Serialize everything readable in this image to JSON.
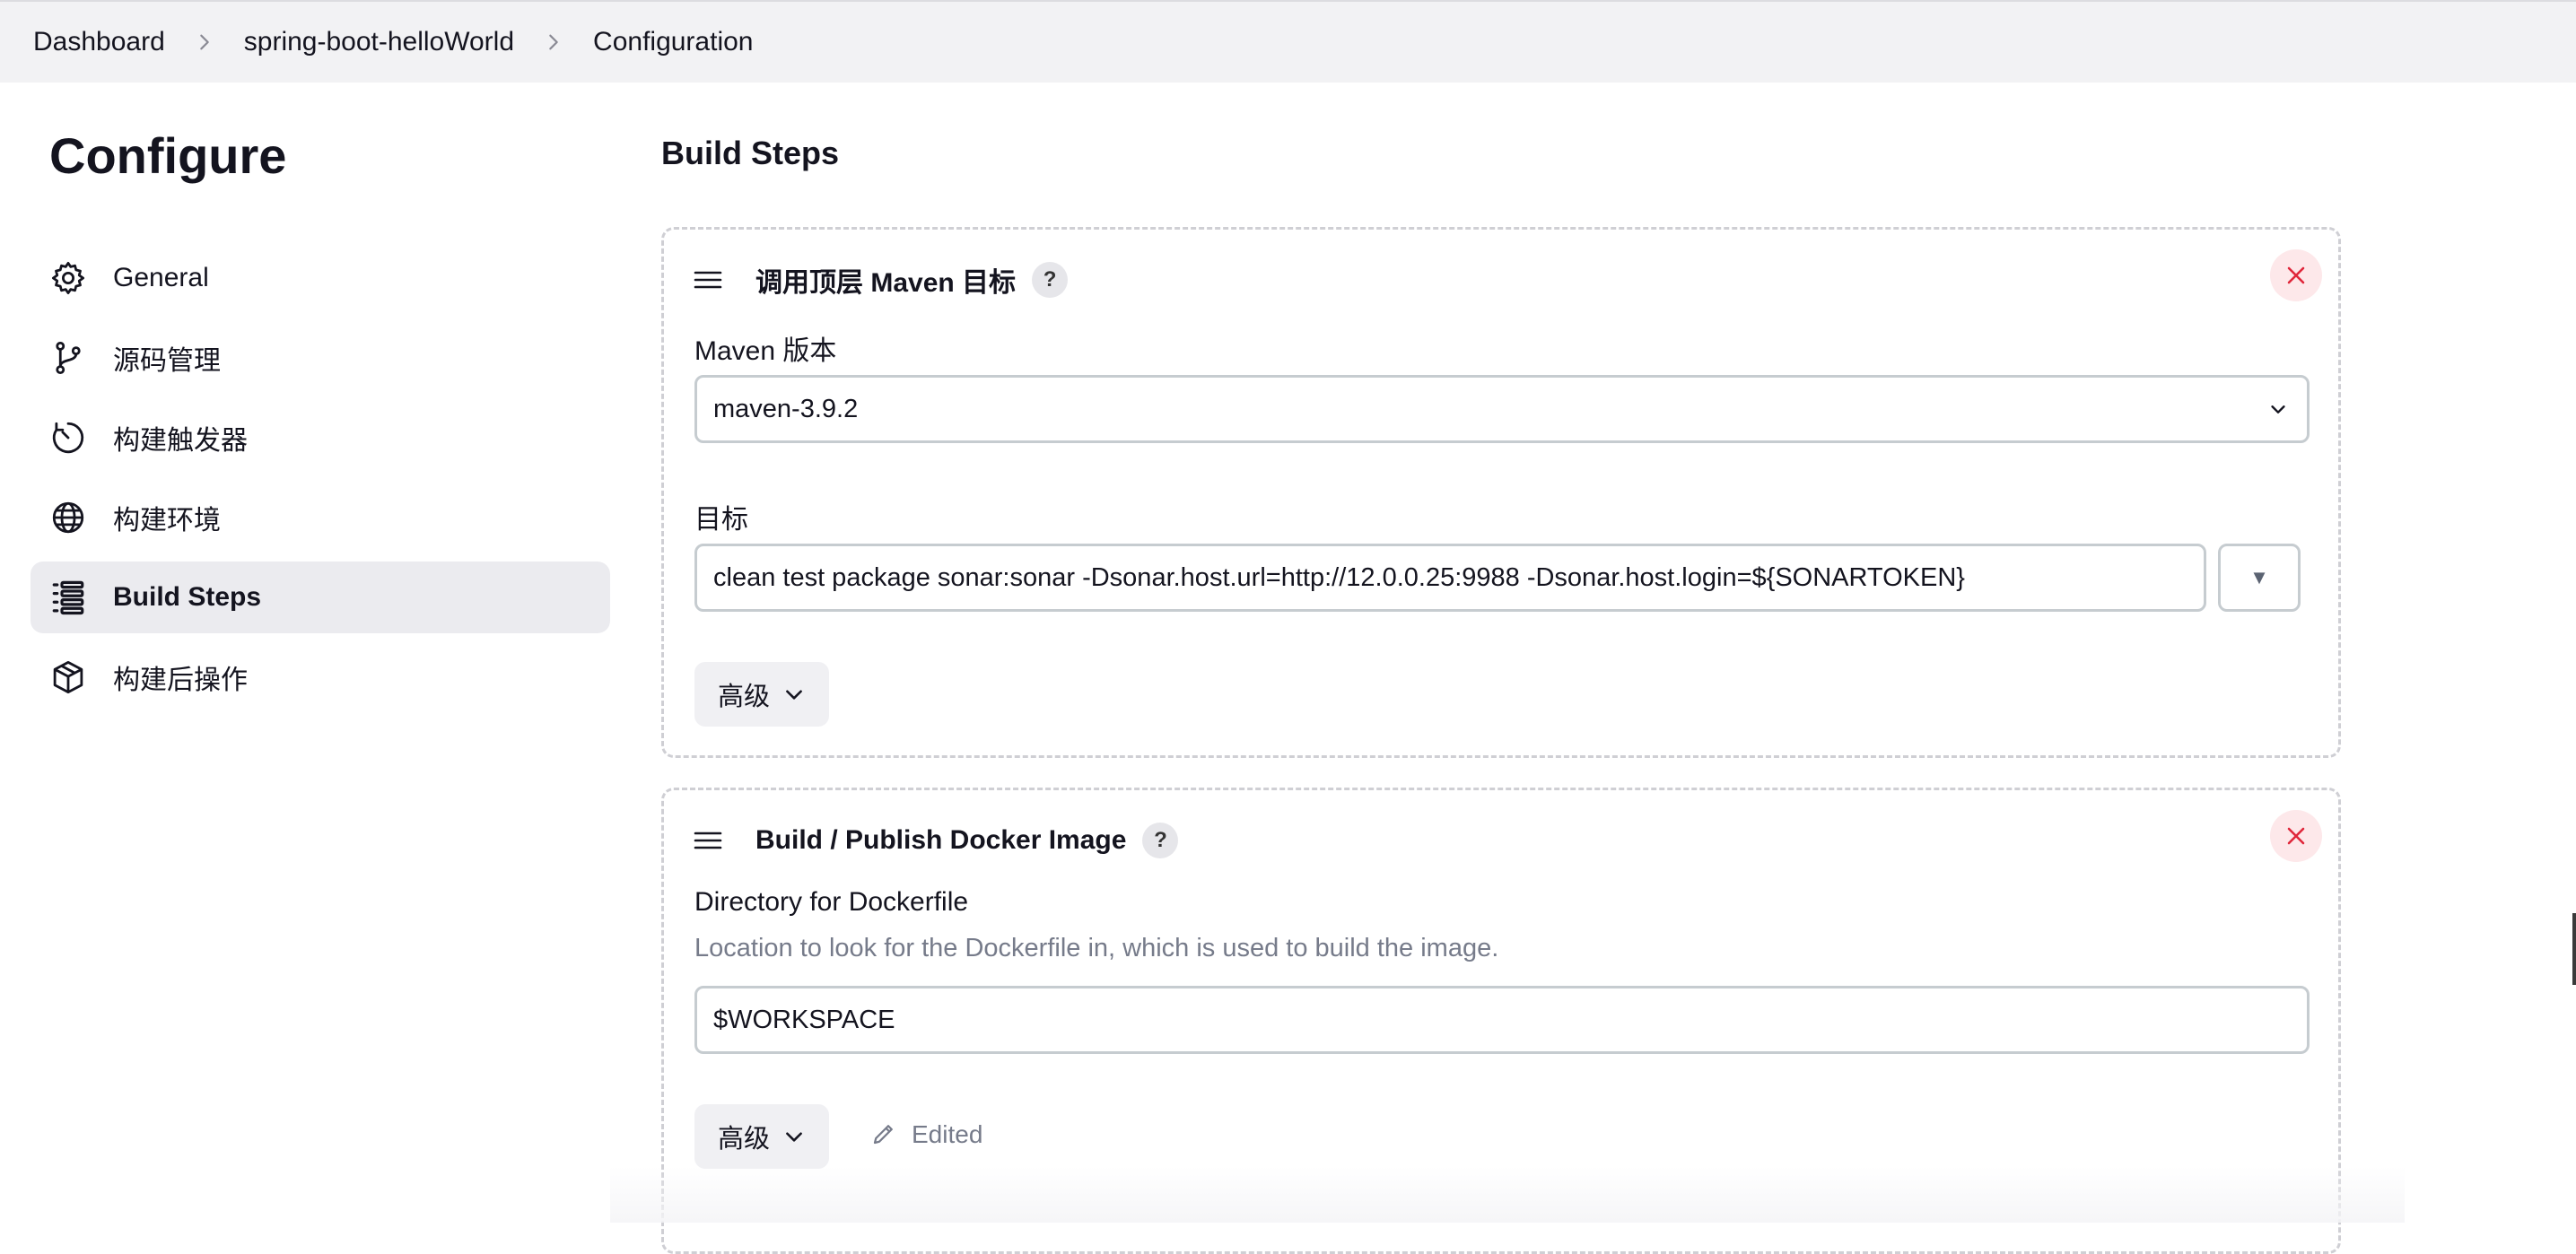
{
  "breadcrumb": {
    "items": [
      "Dashboard",
      "spring-boot-helloWorld",
      "Configuration"
    ]
  },
  "sidebar": {
    "title": "Configure",
    "items": [
      {
        "label": "General",
        "icon": "gear-icon",
        "active": false
      },
      {
        "label": "源码管理",
        "icon": "git-branch-icon",
        "active": false
      },
      {
        "label": "构建触发器",
        "icon": "timer-icon",
        "active": false
      },
      {
        "label": "构建环境",
        "icon": "globe-icon",
        "active": false
      },
      {
        "label": "Build Steps",
        "icon": "list-steps-icon",
        "active": true
      },
      {
        "label": "构建后操作",
        "icon": "package-icon",
        "active": false
      }
    ]
  },
  "main": {
    "section_title": "Build Steps",
    "steps": [
      {
        "title": "调用顶层 Maven 目标",
        "help": "?",
        "maven_version_label": "Maven 版本",
        "maven_version_value": "maven-3.9.2",
        "goals_label": "目标",
        "goals_value": "clean test package sonar:sonar -Dsonar.host.url=http://12.0.0.25:9988 -Dsonar.host.login=${SONARTOKEN}",
        "expand_symbol": "▼",
        "advanced_label": "高级"
      },
      {
        "title": "Build / Publish Docker Image",
        "help": "?",
        "dockerfile_dir_label": "Directory for Dockerfile",
        "dockerfile_dir_description": "Location to look for the Dockerfile in, which is used to build the image.",
        "dockerfile_dir_value": "$WORKSPACE",
        "advanced_label": "高级",
        "edited_label": "Edited"
      }
    ]
  },
  "colors": {
    "accent_danger": "#e0263a",
    "active_nav_bg": "#ebebef",
    "breadcrumb_bg": "#f2f2f4",
    "muted_text": "#767b8a"
  }
}
